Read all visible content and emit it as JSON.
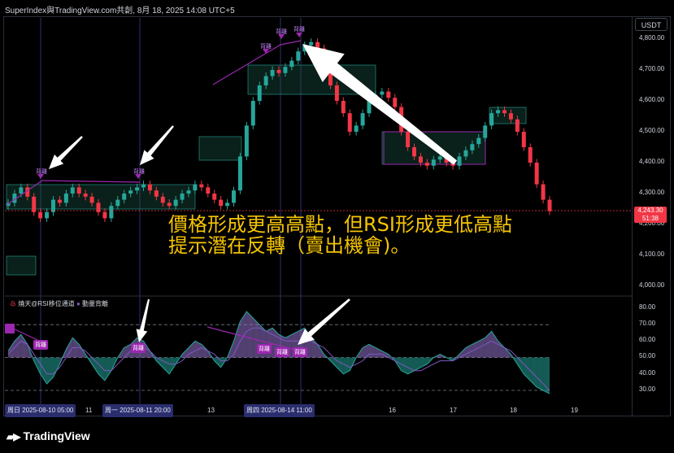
{
  "header": {
    "title": "SuperIndex與TradingView.com共創, 8月 18, 2025 14:08 UTC+5"
  },
  "price_axis": {
    "currency": "USDT",
    "ticks": [
      "4,800.00",
      "4,700.00",
      "4,600.00",
      "4,500.00",
      "4,400.00",
      "4,300.00",
      "4,200.00",
      "4,100.00",
      "4,000.00"
    ],
    "last_price": "4,243.30",
    "countdown": "51:38"
  },
  "rsi_axis": {
    "ticks": [
      "80.00",
      "70.00",
      "60.00",
      "50.00",
      "40.00",
      "30.00"
    ]
  },
  "rsi_legend": {
    "icon": "fire-icon",
    "indicator": "燒天@RSI移位通道",
    "icon2": "dot-icon",
    "label2": "動量背離"
  },
  "annotation": {
    "line1": "價格形成更高高點，但RSI形成更低高點",
    "line2": "提示潛在反轉（賣出機會)。"
  },
  "divergence_label": "背離",
  "x_axis": {
    "labels": [
      "11",
      "13",
      "16",
      "17",
      "18",
      "19"
    ],
    "highlighted": [
      "周日 2025-08-10   05:00",
      "周一 2025-08-11   20:00",
      "周四 2025-08-14   11:00"
    ]
  },
  "brand": {
    "name": "TradingView",
    "icon": "tradingview-logo-icon"
  },
  "colors": {
    "up": "#26a69a",
    "up_body": "#089981",
    "down": "#f23645",
    "divergence": "#9c27b0",
    "annotation": "#f5c400",
    "rsi_line": "#7e57c2",
    "zone": "#1e5c4a"
  },
  "chart_data": [
    {
      "type": "candlestick",
      "title": "",
      "xlabel": "",
      "ylabel": "",
      "ylim": [
        4000,
        4850
      ],
      "closes_approx": [
        4270,
        4300,
        4320,
        4290,
        4240,
        4220,
        4240,
        4280,
        4270,
        4300,
        4320,
        4300,
        4290,
        4270,
        4240,
        4220,
        4260,
        4280,
        4300,
        4310,
        4320,
        4330,
        4310,
        4290,
        4270,
        4260,
        4280,
        4300,
        4310,
        4330,
        4320,
        4300,
        4280,
        4260,
        4270,
        4310,
        4420,
        4520,
        4600,
        4650,
        4680,
        4700,
        4690,
        4710,
        4730,
        4760,
        4780,
        4790,
        4770,
        4700,
        4650,
        4600,
        4560,
        4500,
        4520,
        4560,
        4600,
        4620,
        4630,
        4610,
        4580,
        4500,
        4450,
        4420,
        4400,
        4390,
        4410,
        4420,
        4400,
        4390,
        4420,
        4440,
        4460,
        4480,
        4520,
        4560,
        4570,
        4560,
        4540,
        4500,
        4450,
        4400,
        4330,
        4280,
        4243
      ],
      "annotations": [
        {
          "text": "背離",
          "x": "2025-08-10",
          "price": 4340
        },
        {
          "text": "背離",
          "x": "2025-08-11",
          "price": 4340
        },
        {
          "text": "背離",
          "x": "2025-08-14",
          "price": 4800
        },
        {
          "text": "背離",
          "x": "2025-08-14",
          "price": 4810
        }
      ]
    },
    {
      "type": "line",
      "title": "",
      "ylim": [
        25,
        85
      ],
      "levels": [
        70,
        50,
        30
      ],
      "series": [
        {
          "values": [
            54,
            60,
            64,
            58,
            48,
            40,
            34,
            38,
            46,
            55,
            62,
            58,
            52,
            46,
            40,
            36,
            42,
            50,
            56,
            58,
            62,
            60,
            54,
            48,
            44,
            40,
            46,
            52,
            56,
            60,
            58,
            54,
            48,
            44,
            50,
            60,
            72,
            78,
            74,
            70,
            66,
            68,
            64,
            62,
            64,
            66,
            68,
            62,
            58,
            52,
            48,
            44,
            40,
            42,
            50,
            56,
            58,
            56,
            54,
            52,
            48,
            42,
            40,
            42,
            44,
            46,
            50,
            52,
            50,
            48,
            52,
            56,
            58,
            60,
            62,
            66,
            60,
            56,
            52,
            46,
            40,
            36,
            32,
            30,
            28
          ]
        },
        {
          "values": [
            52,
            56,
            60,
            58,
            52,
            46,
            40,
            40,
            44,
            50,
            56,
            56,
            54,
            50,
            46,
            42,
            42,
            46,
            50,
            54,
            56,
            56,
            54,
            50,
            48,
            46,
            46,
            48,
            52,
            54,
            56,
            54,
            52,
            48,
            48,
            52,
            60,
            66,
            68,
            68,
            66,
            64,
            62,
            60,
            60,
            60,
            62,
            60,
            58,
            56,
            52,
            48,
            46,
            44,
            46,
            48,
            52,
            52,
            52,
            50,
            48,
            46,
            44,
            42,
            42,
            44,
            46,
            48,
            48,
            48,
            50,
            52,
            54,
            56,
            58,
            60,
            58,
            56,
            54,
            50,
            46,
            42,
            38,
            34,
            30
          ]
        }
      ]
    }
  ]
}
